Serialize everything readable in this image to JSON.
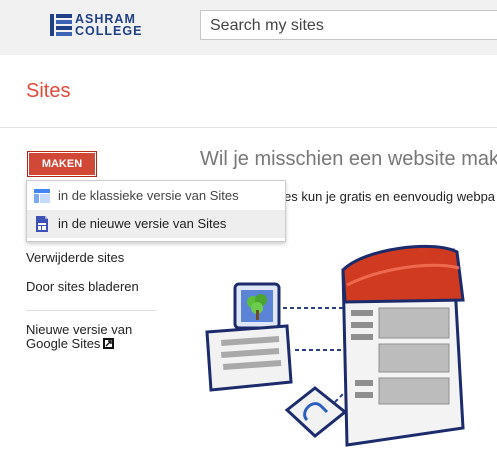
{
  "header": {
    "logo_line1": "ASHRAM",
    "logo_line2": "COLLEGE",
    "search_placeholder": "Search my sites"
  },
  "page_title": "Sites",
  "create_button": "MAKEN",
  "create_menu": {
    "items": [
      {
        "label": "in de klassieke versie van Sites",
        "icon": "classic-sites-icon"
      },
      {
        "label": "in de nieuwe versie van Sites",
        "icon": "new-sites-icon"
      }
    ]
  },
  "nav": {
    "deleted_sites": "Verwijderde sites",
    "browse_sites": "Door sites bladeren",
    "new_version_line1": "Nieuwe versie van",
    "new_version_line2": "Google Sites"
  },
  "main": {
    "headline": "Wil je misschien een website mak",
    "subline": "es kun je gratis en eenvoudig webpa"
  },
  "colors": {
    "accent_red": "#dd4b39",
    "button_red": "#d14836",
    "logo_blue": "#1f3f86"
  }
}
